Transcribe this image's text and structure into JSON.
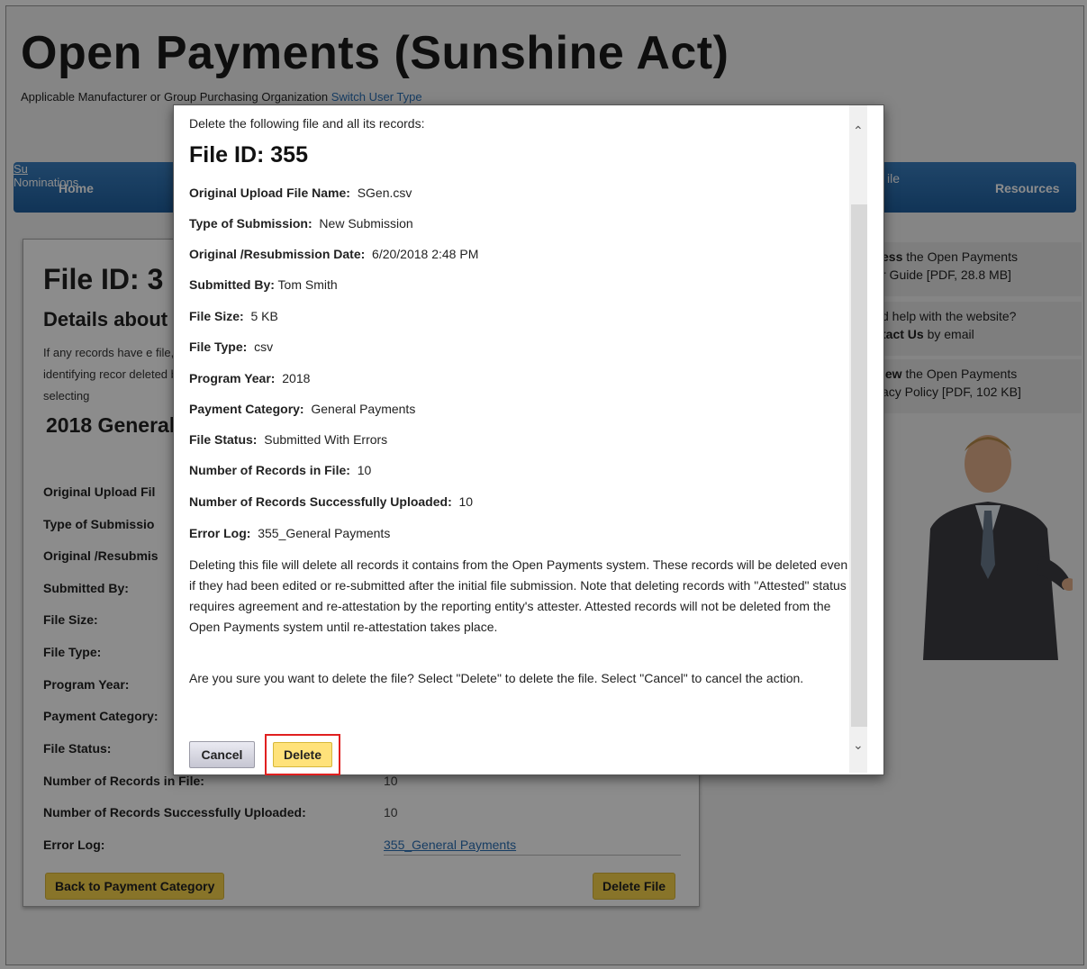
{
  "header": {
    "site_title": "Open Payments (Sunshine Act)",
    "user_type_label": "Applicable Manufacturer or Group Purchasing Organization",
    "switch_link": "Switch User Type"
  },
  "nav": {
    "home": "Home",
    "submissions_partial": "Su",
    "file_partial": "ile",
    "nominations_partial": "Nominations",
    "resources": "Resources"
  },
  "page": {
    "title_partial": "File ID: 3",
    "subtitle_partial": "Details about",
    "intro_partial": "If any records have e file, identifying recor deleted by selecting",
    "year_heading_partial": "2018 General",
    "rows": [
      {
        "label": "Original Upload Fil",
        "value": ""
      },
      {
        "label": "Type of Submissio",
        "value": ""
      },
      {
        "label": "Original /Resubmis",
        "value": ""
      },
      {
        "label": "Submitted By:",
        "value": ""
      },
      {
        "label": "File Size:",
        "value": ""
      },
      {
        "label": "File Type:",
        "value": ""
      },
      {
        "label": "Program Year:",
        "value": ""
      },
      {
        "label": "Payment Category:",
        "value": ""
      },
      {
        "label": "File Status:",
        "value": ""
      },
      {
        "label": "Number of Records in File:",
        "value": "10"
      },
      {
        "label": "Number of Records Successfully Uploaded:",
        "value": "10"
      },
      {
        "label": "Error Log:",
        "value": "355_General Payments"
      }
    ],
    "back_button": "Back to Payment Category",
    "delete_file_button": "Delete File"
  },
  "sidebar": {
    "box1_line1_bold": "ess",
    "box1_line1": " the Open Payments",
    "box1_line2": "r Guide [PDF, 28.8 MB]",
    "box2_line1": "d help with the website?",
    "box2_line2_bold": "tact Us",
    "box2_line2": " by email",
    "box3_line1_bold": "iew",
    "box3_line1": " the Open Payments",
    "box3_line2": "acy Policy [PDF, 102 KB]"
  },
  "modal": {
    "intro": "Delete the following file and all its records:",
    "heading": "File ID: 355",
    "fields": [
      {
        "label": "Original Upload File Name:",
        "value": "SGen.csv"
      },
      {
        "label": "Type of Submission:",
        "value": "New Submission"
      },
      {
        "label": "Original /Resubmission Date:",
        "value": "6/20/2018 2:48 PM"
      },
      {
        "label": "Submitted By:",
        "value": "Tom Smith"
      },
      {
        "label": "File Size:",
        "value": "5 KB"
      },
      {
        "label": "File Type:",
        "value": "csv"
      },
      {
        "label": "Program Year:",
        "value": "2018"
      },
      {
        "label": "Payment Category:",
        "value": "General Payments"
      },
      {
        "label": "File Status:",
        "value": "Submitted With Errors"
      },
      {
        "label": "Number of Records in File:",
        "value": "10"
      },
      {
        "label": "Number of Records Successfully Uploaded:",
        "value": "10"
      },
      {
        "label": "Error Log:",
        "value": "355_General Payments"
      }
    ],
    "warning": "Deleting this file will delete all records it contains from the Open Payments system. These records will be deleted even if they had been edited or re-submitted after the initial file submission. Note that deleting records with \"Attested\" status requires agreement and re-attestation by the reporting entity's attester. Attested records will not be deleted from the Open Payments system until re-attestation takes place.",
    "confirm": "Are you sure you want to delete the file? Select \"Delete\" to delete the file. Select \"Cancel\" to cancel the action.",
    "cancel_label": "Cancel",
    "delete_label": "Delete"
  }
}
